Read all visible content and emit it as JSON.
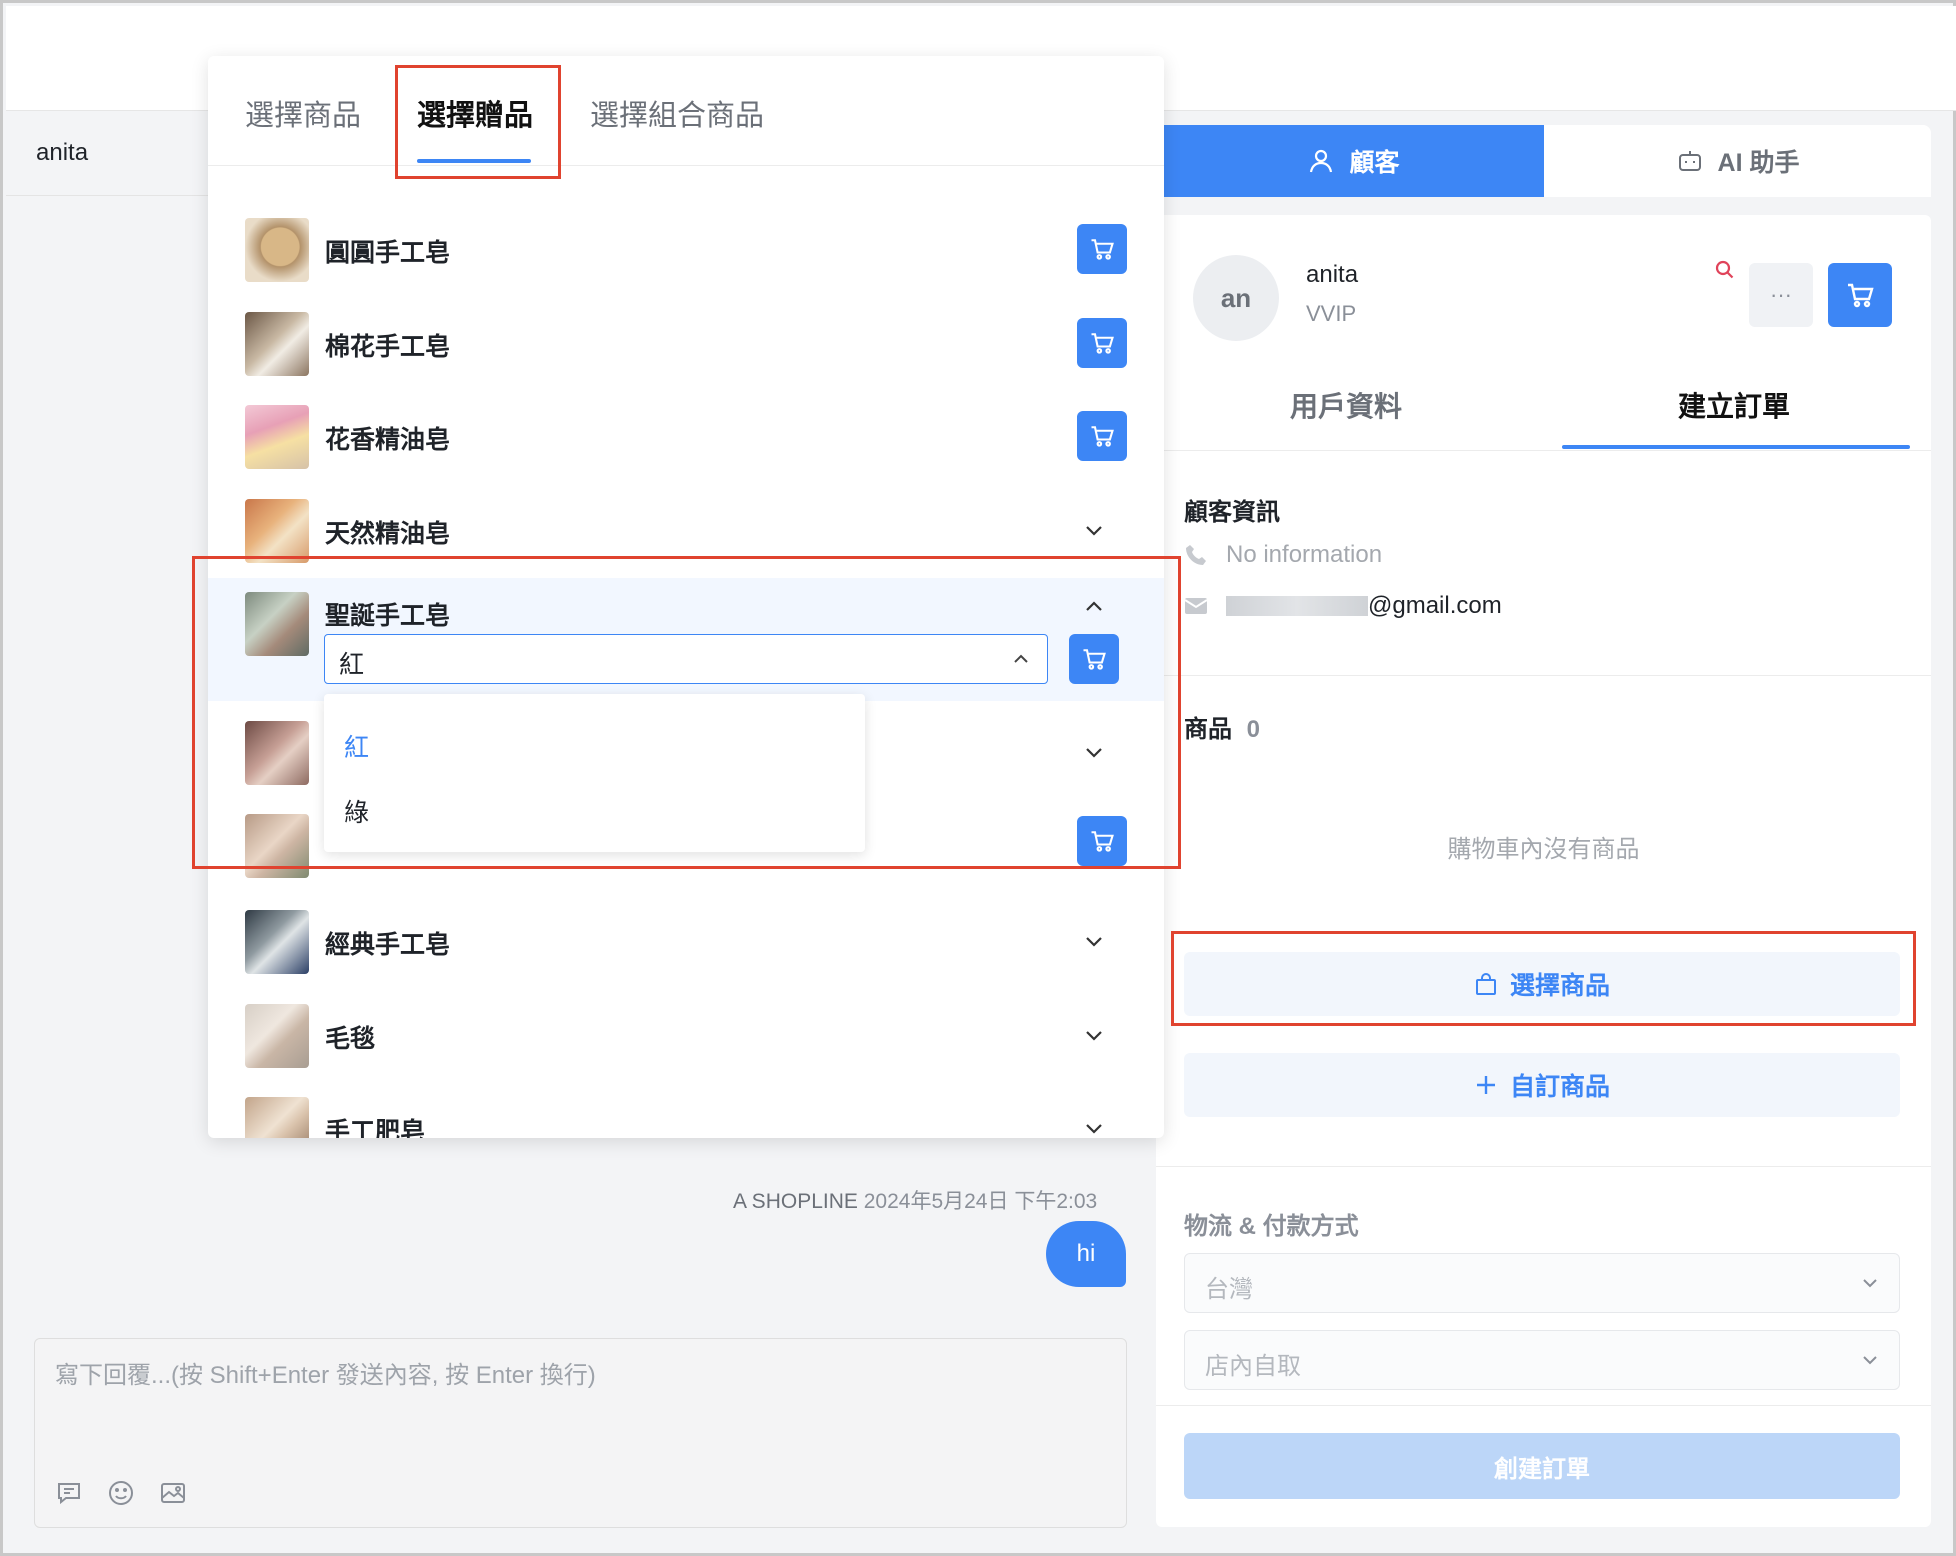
{
  "chat": {
    "contact_name": "anita",
    "message_sender": "A SHOPLINE",
    "message_time": "2024年5月24日 下午2:03",
    "message_text": "hi",
    "composer_placeholder": "寫下回覆...(按 Shift+Enter 發送內容, 按 Enter 換行)"
  },
  "picker": {
    "tabs": [
      "選擇商品",
      "選擇贈品",
      "選擇組合商品"
    ],
    "active_tab": "選擇贈品",
    "products": [
      {
        "name": "圓圓手工皂",
        "action": "cart"
      },
      {
        "name": "棉花手工皂",
        "action": "cart"
      },
      {
        "name": "花香精油皂",
        "action": "cart"
      },
      {
        "name": "天然精油皂",
        "action": "expand"
      },
      {
        "name": "聖誕手工皂",
        "action": "collapse"
      },
      {
        "name": "",
        "action": "expand"
      },
      {
        "name": "",
        "action": "cart"
      },
      {
        "name": "經典手工皂",
        "action": "expand"
      },
      {
        "name": "毛毯",
        "action": "expand"
      },
      {
        "name": "手工肥皂",
        "action": "expand"
      }
    ],
    "variant_select_value": "紅",
    "variant_options": [
      "紅",
      "綠"
    ],
    "variant_selected": "紅"
  },
  "right": {
    "tab_customer": "顧客",
    "tab_ai": "AI 助手",
    "avatar_initials": "an",
    "user_name": "anita",
    "user_tier": "VVIP",
    "more_label": "···",
    "subtab_profile": "用戶資料",
    "subtab_order": "建立訂單",
    "customer_info_title": "顧客資訊",
    "phone": "No information",
    "email_suffix": "@gmail.com",
    "products_title": "商品",
    "products_count": "0",
    "cart_empty": "購物車內沒有商品",
    "select_products_btn": "選擇商品",
    "custom_product_btn": "自訂商品",
    "shipping_title": "物流 & 付款方式",
    "country_select": "台灣",
    "delivery_select": "店內自取",
    "create_order_btn": "創建訂單"
  },
  "colors": {
    "accent": "#3d86f5",
    "highlight": "#e0432f"
  }
}
